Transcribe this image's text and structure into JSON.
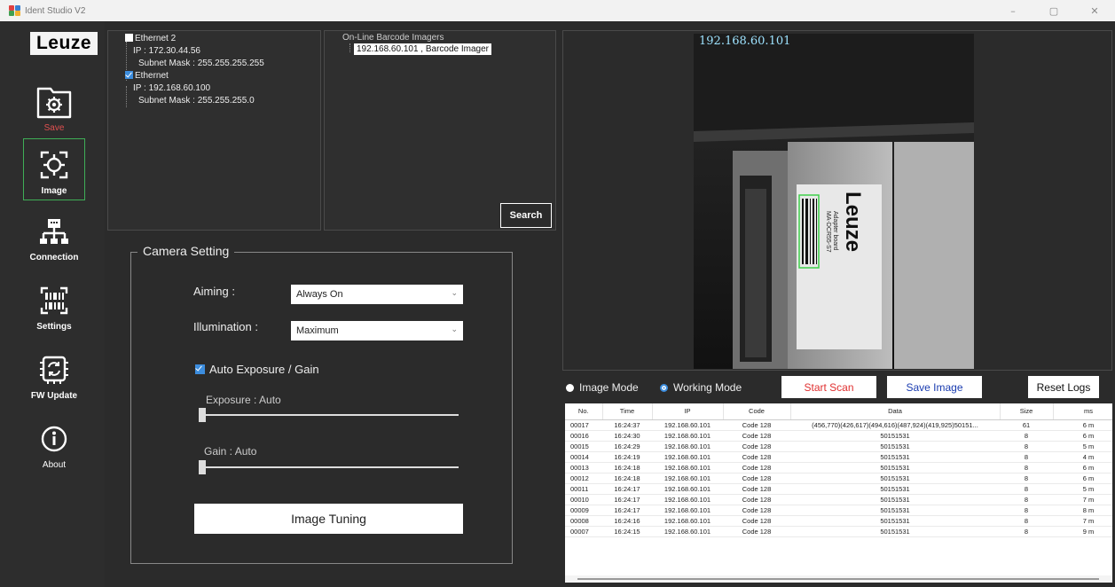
{
  "window": {
    "title": "Ident Studio V2",
    "min": "–",
    "max": "▢",
    "close": "✕"
  },
  "brand": {
    "logo": "Leuze"
  },
  "nav": [
    {
      "id": "save",
      "label": "Save",
      "icon": "gear-icon"
    },
    {
      "id": "image",
      "label": "Image",
      "icon": "crosshair-icon"
    },
    {
      "id": "connection",
      "label": "Connection",
      "icon": "network-icon"
    },
    {
      "id": "settings",
      "label": "Settings",
      "icon": "barcode-icon"
    },
    {
      "id": "fwupdate",
      "label": "FW Update",
      "icon": "chip-refresh-icon"
    },
    {
      "id": "about",
      "label": "About",
      "icon": "info-icon"
    }
  ],
  "network": {
    "adapters": [
      {
        "name": "Ethernet 2",
        "checked": false,
        "ip": "IP : 172.30.44.56",
        "mask": "Subnet Mask : 255.255.255.255"
      },
      {
        "name": "Ethernet",
        "checked": true,
        "ip": "IP : 192.168.60.100",
        "mask": "Subnet Mask : 255.255.255.0"
      }
    ]
  },
  "imagers": {
    "title": "On-Line Barcode Imagers",
    "items": [
      "192.168.60.101 , Barcode Imager"
    ],
    "search_label": "Search"
  },
  "camera": {
    "legend": "Camera Setting",
    "aiming_label": "Aiming :",
    "aiming_value": "Always On",
    "illumination_label": "Illumination :",
    "illumination_value": "Maximum",
    "auto_label": "Auto Exposure / Gain",
    "auto_checked": true,
    "exposure_label": "Exposure : Auto",
    "exposure_level": 0,
    "gain_label": "Gain : Auto",
    "gain_level": 0,
    "tuning_label": "Image Tuning"
  },
  "preview": {
    "ip": "192.168.60.101",
    "box_text": "Leuze",
    "box_small1": "MA-DCR55-S7",
    "box_small2": "Adapter board"
  },
  "controls": {
    "image_mode": "Image Mode",
    "working_mode": "Working Mode",
    "selected_mode": "working",
    "start_scan": "Start Scan",
    "save_image": "Save Image",
    "reset_logs": "Reset Logs"
  },
  "log": {
    "columns": [
      "No.",
      "Time",
      "IP",
      "Code",
      "Data",
      "Size",
      "ms"
    ],
    "rows": [
      [
        "00017",
        "16:24:37",
        "192.168.60.101",
        "Code 128",
        "(456,770)(426,617)(494,616)(487,924)(419,925)50151...",
        "61",
        "6 m"
      ],
      [
        "00016",
        "16:24:30",
        "192.168.60.101",
        "Code 128",
        "50151531",
        "8",
        "6 m"
      ],
      [
        "00015",
        "16:24:29",
        "192.168.60.101",
        "Code 128",
        "50151531",
        "8",
        "5 m"
      ],
      [
        "00014",
        "16:24:19",
        "192.168.60.101",
        "Code 128",
        "50151531",
        "8",
        "4 m"
      ],
      [
        "00013",
        "16:24:18",
        "192.168.60.101",
        "Code 128",
        "50151531",
        "8",
        "6 m"
      ],
      [
        "00012",
        "16:24:18",
        "192.168.60.101",
        "Code 128",
        "50151531",
        "8",
        "6 m"
      ],
      [
        "00011",
        "16:24:17",
        "192.168.60.101",
        "Code 128",
        "50151531",
        "8",
        "5 m"
      ],
      [
        "00010",
        "16:24:17",
        "192.168.60.101",
        "Code 128",
        "50151531",
        "8",
        "7 m"
      ],
      [
        "00009",
        "16:24:17",
        "192.168.60.101",
        "Code 128",
        "50151531",
        "8",
        "8 m"
      ],
      [
        "00008",
        "16:24:16",
        "192.168.60.101",
        "Code 128",
        "50151531",
        "8",
        "7 m"
      ],
      [
        "00007",
        "16:24:15",
        "192.168.60.101",
        "Code 128",
        "50151531",
        "8",
        "9 m"
      ]
    ]
  },
  "colors": {
    "accent": "#3c8dde",
    "active_border": "#3fae57",
    "start_scan": "#e03030",
    "save_image": "#1a3cb0",
    "save_label": "#e05050"
  }
}
